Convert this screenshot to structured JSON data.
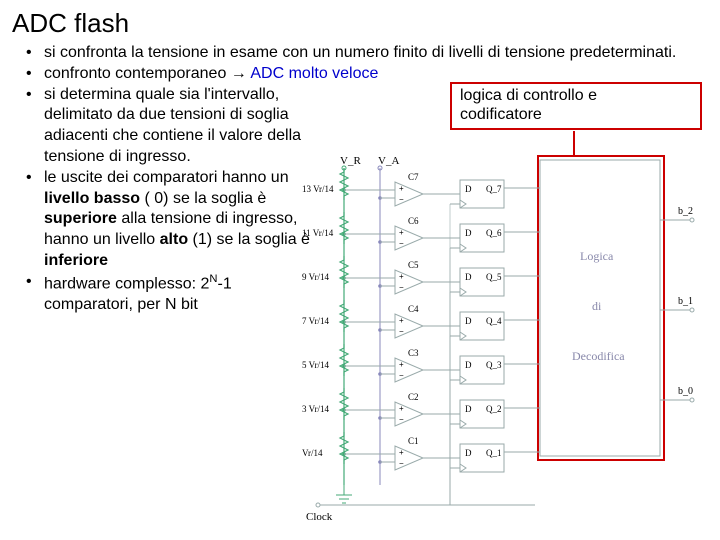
{
  "title": "ADC flash",
  "bullets": [
    {
      "text": "si confronta la tensione in esame con un numero finito di livelli di tensione predeterminati."
    },
    {
      "pre": "confronto contemporaneo → ",
      "adc": "ADC molto veloce"
    },
    {
      "text": "si determina quale sia l'intervallo, delimitato da due tensioni di soglia adiacenti che contiene il valore della tensione di ingresso."
    },
    {
      "p1": "le uscite dei comparatori hanno un ",
      "b1": "livello basso",
      "p2": " ( 0) se la soglia è ",
      "b2": "superiore",
      "p3": " alla tensione di ingresso, hanno un livello ",
      "b3": "alto",
      "p4": " (1) se la soglia è ",
      "b4": "inferiore"
    },
    {
      "p1": "hardware complesso: 2",
      "sup": "N",
      "p2": "-1 comparatori, per N bit"
    }
  ],
  "redbox": {
    "line1": "logica di controllo e",
    "line2": "codificatore"
  },
  "diagram": {
    "vr": "V_R",
    "va": "V_A",
    "clock": "Clock",
    "logic1": "Logica",
    "logic2": "di",
    "logic3": "Decodifica",
    "resistor_labels": [
      "13 Vr/14",
      "11 Vr/14",
      "9 Vr/14",
      "7 Vr/14",
      "5 Vr/14",
      "3 Vr/14",
      "Vr/14"
    ],
    "comparators": [
      "C7",
      "C6",
      "C5",
      "C4",
      "C3",
      "C2",
      "C1"
    ],
    "flipflops": [
      {
        "d": "D",
        "q": "Q_7"
      },
      {
        "d": "D",
        "q": "Q_6"
      },
      {
        "d": "D",
        "q": "Q_5"
      },
      {
        "d": "D",
        "q": "Q_4"
      },
      {
        "d": "D",
        "q": "Q_3"
      },
      {
        "d": "D",
        "q": "Q_2"
      },
      {
        "d": "D",
        "q": "Q_1"
      }
    ],
    "outputs": [
      "b_2",
      "b_1",
      "b_0"
    ]
  }
}
